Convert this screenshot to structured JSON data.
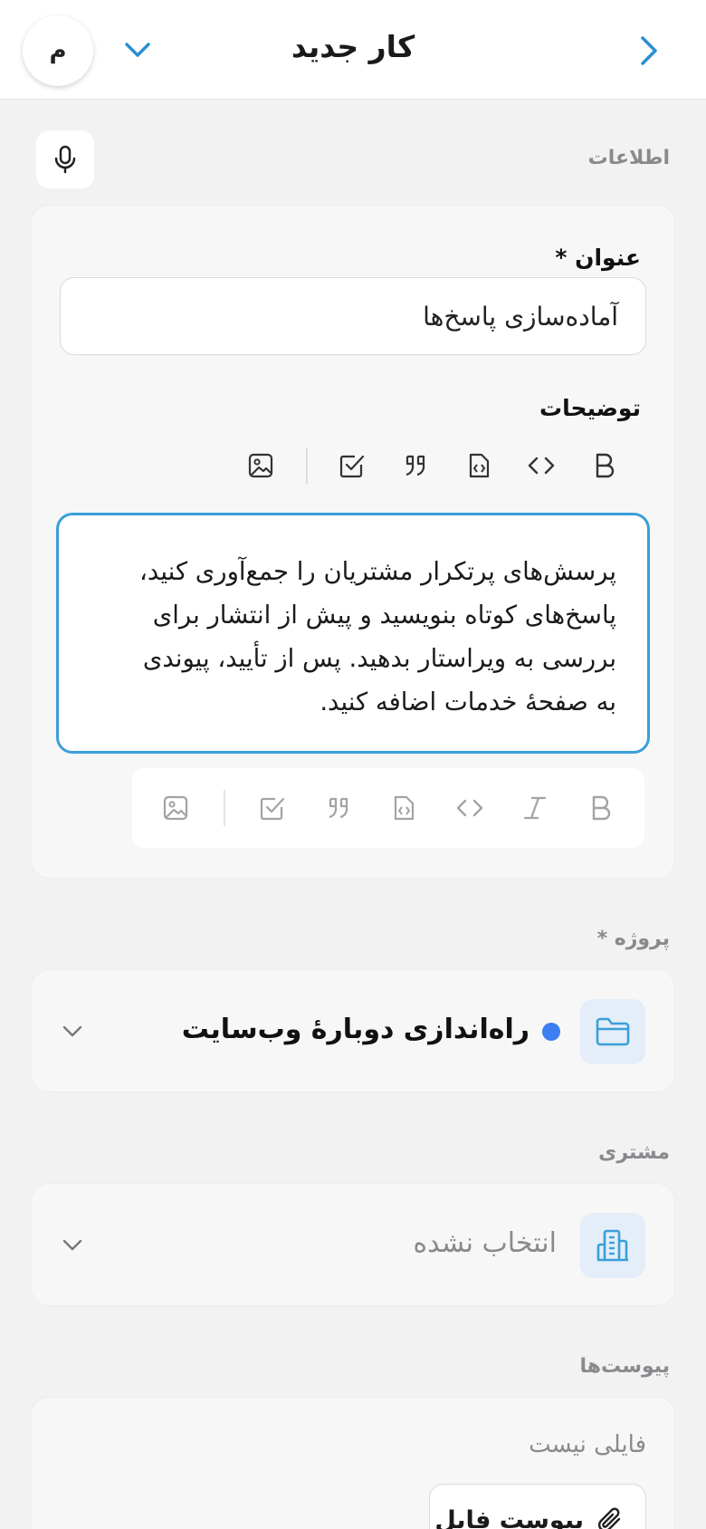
{
  "header": {
    "title": "کار جدید",
    "avatar_letter": "م"
  },
  "info_section": {
    "label": "اطلاعات"
  },
  "title_field": {
    "label": "عنوان *",
    "value": "آماده‌سازی پاسخ‌ها"
  },
  "description_field": {
    "label": "توضیحات",
    "lines": [
      "پرسش‌های پرتکرار مشتریان را جمع‌آوری کنید،",
      "پاسخ‌های کوتاه بنویسید و پیش از انتشار برای",
      "بررسی به ویراستار بدهید. پس از تأیید، پیوندی",
      "به صفحهٔ خدمات اضافه کنید."
    ]
  },
  "project_section": {
    "label": "پروژه *",
    "selected": "راه‌اندازی دوبارهٔ وب‌سایت",
    "dot_color": "#3d7ef0"
  },
  "customer_section": {
    "label": "مشتری",
    "selected": "انتخاب نشده"
  },
  "attachments_section": {
    "label": "پیوست‌ها",
    "empty_text": "فایلی نیست",
    "attach_button": "پیوست فایل"
  },
  "colors": {
    "accent": "#3a9fd8",
    "icon_blue": "#3a9fd8",
    "background": "#f2f2f3"
  }
}
